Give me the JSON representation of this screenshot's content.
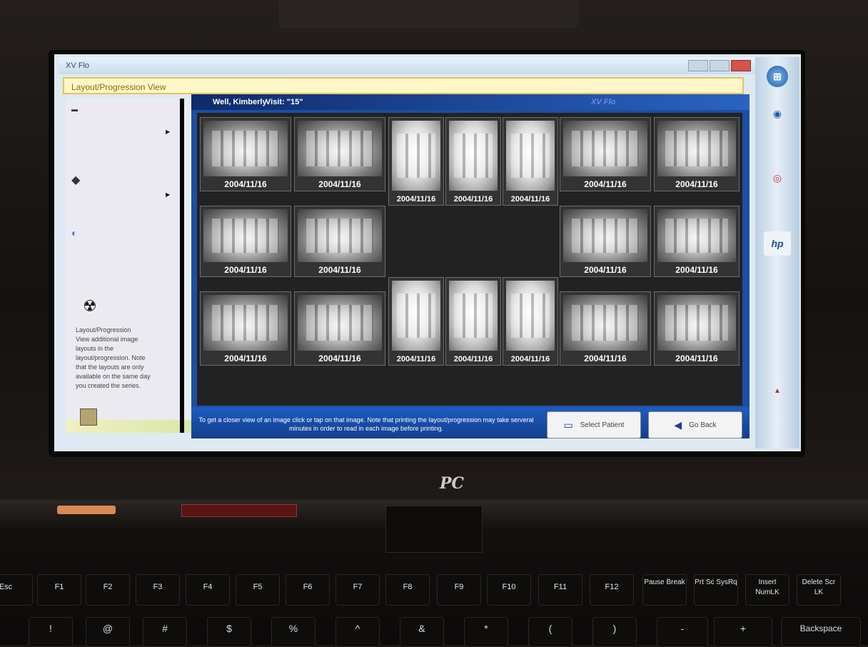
{
  "window": {
    "title": "XV Flo",
    "address": "Layout/Progression View"
  },
  "patient": {
    "name": "Well, Kimberly",
    "visit": "Visit: \"15\"",
    "brand": "XV Flo"
  },
  "left_panel": {
    "hazard_icon": "radiation-icon",
    "info_lines": [
      "Layout/Progression",
      "View additional image",
      "layouts in the",
      "layout/progression. Note",
      "that the layouts are only",
      "available on the same day",
      "you created the series."
    ]
  },
  "xrays": {
    "dates": [
      "2004/11/16",
      "2004/11/16",
      "2004/11/16",
      "2004/11/16",
      "2004/11/16",
      "2004/11/16",
      "2004/11/16",
      "2004/11/16",
      "2004/11/16",
      "2004/11/16",
      "2004/11/16",
      "2004/11/16",
      "2004/11/16",
      "2004/11/16",
      "2004/11/16",
      "2004/11/16",
      "2004/11/16",
      "2004/11/16"
    ]
  },
  "bottom": {
    "note": "To get a closer view of an image click or tap on that image.  Note that printing the layout/progression may take serveral minutes in order to read in each image before printing.",
    "select_patient": "Select Patient",
    "go_back": "Go Back"
  },
  "laptop": {
    "logo": "PC",
    "function_keys": [
      "F1",
      "F2",
      "F3",
      "F4",
      "F5",
      "F6",
      "F7",
      "F8",
      "F9",
      "F10",
      "F11",
      "F12",
      "Pause Break",
      "Prt Sc SysRq",
      "Insert NumLK",
      "Delete Scr LK"
    ],
    "number_row": [
      "!",
      "@",
      "#",
      "$",
      "%",
      "^",
      "&",
      "*",
      "(",
      ")",
      "-",
      "+",
      "Backspace"
    ]
  },
  "colors": {
    "app_blue": "#1a4fa3",
    "addressbar_yellow": "#fff7c8"
  }
}
